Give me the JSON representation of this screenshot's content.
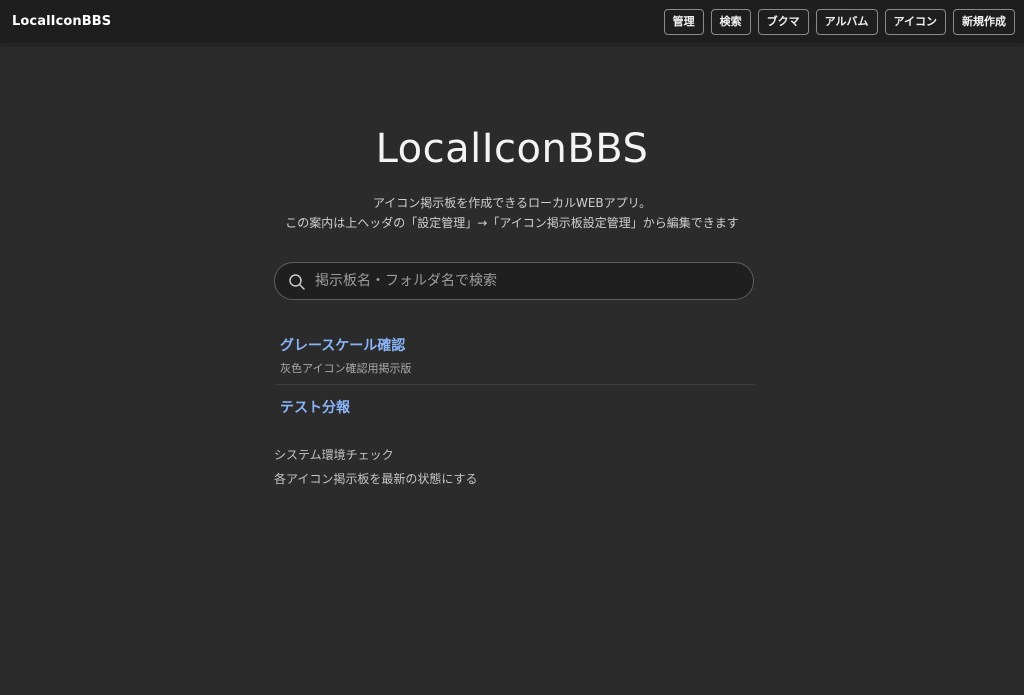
{
  "header": {
    "brand": "LocalIconBBS",
    "nav": [
      "管理",
      "検索",
      "ブクマ",
      "アルバム",
      "アイコン",
      "新規作成"
    ]
  },
  "hero": {
    "title": "LocalIconBBS",
    "desc_line1": "アイコン掲示板を作成できるローカルWEBアプリ。",
    "desc_line2": "この案内は上ヘッダの「設定管理」→「アイコン掲示板設定管理」から編集できます"
  },
  "search": {
    "icon": "search-icon",
    "placeholder": "掲示板名・フォルダ名で検索",
    "value": ""
  },
  "boards": [
    {
      "name": "グレースケール確認",
      "desc": "灰色アイコン確認用掲示版"
    },
    {
      "name": "テスト分報",
      "desc": ""
    }
  ],
  "links": [
    "システム環境チェック",
    "各アイコン掲示板を最新の状態にする"
  ],
  "colors": {
    "background": "#2b2b2b",
    "topbar": "#1e1e1e",
    "link": "#8ab4f8"
  }
}
